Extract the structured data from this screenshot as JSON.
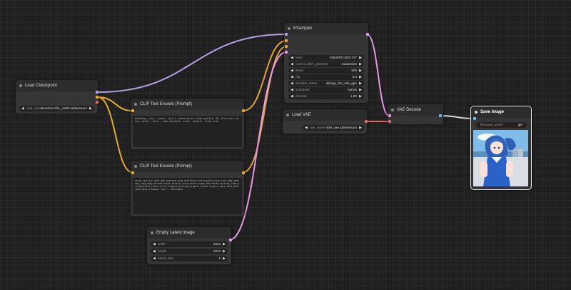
{
  "colors": {
    "clip": "#e4ad2a",
    "model": "#b3a2e0",
    "latent": "#e49ae0",
    "vae": "#e06767",
    "image": "#6fb8e8",
    "conditioning": "#e4a23a"
  },
  "nodes": {
    "load_checkpoint": {
      "title": "Load Checkpoint",
      "ckpt_label": "ckpt_name",
      "ckpt_value": "bluePencilXL_v200.safetensors"
    },
    "clip_pos": {
      "title": "CLIP Text Encode (Prompt)",
      "text": "building, city , ocean, (girl), masterpiece, high quality, 8k, blue hair, dress, smile , kind , side ponytail, visor, oceanic, cross arms"
    },
    "clip_neg": {
      "title": "CLIP Text Encode (Prompt)",
      "text": "worst quality,ugly,bad anatomy,jpeg artifacts,extra,extra,nsfw,text,bad anatomy,long_body,missed hands,missing prop,extra props,bad hands,missing_limb,disconnected_limbs,extra_fingers,missing_fingers,fused fingers,ugly face,deformed eyes,cropped, text , watermark"
    },
    "empty_latent": {
      "title": "Empty Latent Image",
      "widgets": [
        {
          "label": "width",
          "value": "1024"
        },
        {
          "label": "height",
          "value": "1024"
        },
        {
          "label": "batch_size",
          "value": "1"
        }
      ]
    },
    "ksampler": {
      "title": "KSampler",
      "widgets": [
        {
          "label": "seed",
          "value": "495309713001747"
        },
        {
          "label": "control_after_generate",
          "value": "randomize"
        },
        {
          "label": "steps",
          "value": "500"
        },
        {
          "label": "cfg",
          "value": "8.0"
        },
        {
          "label": "sampler_name",
          "value": "dpmpp_3m_sde_gpu"
        },
        {
          "label": "scheduler",
          "value": "karras"
        },
        {
          "label": "denoise",
          "value": "1.00"
        }
      ]
    },
    "load_vae": {
      "title": "Load VAE",
      "vae_label": "vae_name",
      "vae_value": "sdxl_vae.safetensors"
    },
    "vae_decode": {
      "title": "VAE Decode"
    },
    "save_image": {
      "title": "Save Image",
      "prefix_label": "filename_prefix",
      "prefix_value": "girl"
    }
  }
}
